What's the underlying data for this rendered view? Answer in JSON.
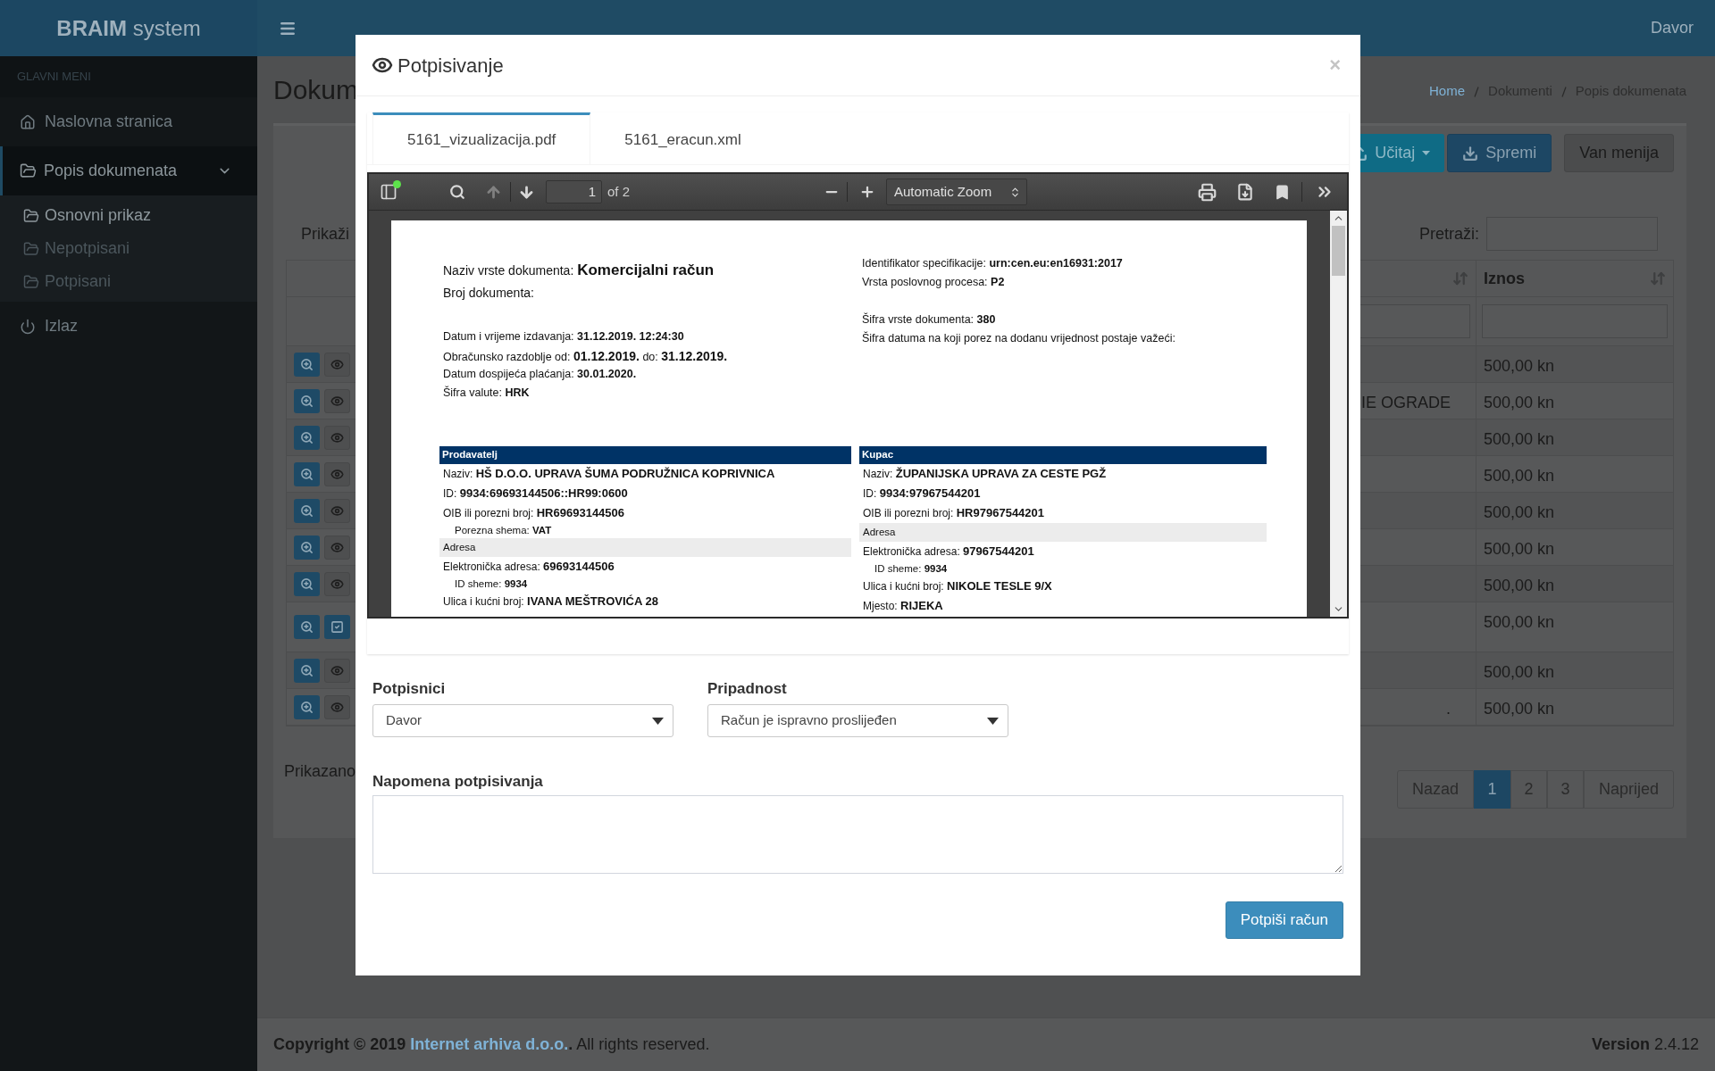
{
  "app": {
    "logo_bold": "BRAIM",
    "logo_light": "system",
    "user": "Davor"
  },
  "sidebar": {
    "heading": "GLAVNI MENI",
    "items": [
      {
        "kind": "link",
        "label": "Naslovna stranica"
      },
      {
        "kind": "group",
        "label": "Popis dokumenata",
        "expanded": true,
        "children": [
          {
            "label": "Osnovni prikaz",
            "selected": true
          },
          {
            "label": "Nepotpisani",
            "selected": false
          },
          {
            "label": "Potpisani",
            "selected": false
          }
        ]
      },
      {
        "kind": "link",
        "label": "Izlaz"
      }
    ]
  },
  "page": {
    "title": "Dokum",
    "breadcrumb": [
      "Home",
      "Dokumenti",
      "Popis dokumenata"
    ]
  },
  "actions": [
    {
      "kind": "info",
      "label": "Učitaj"
    },
    {
      "kind": "primary",
      "label": "Spremi"
    },
    {
      "kind": "plain",
      "label": "Van menija"
    }
  ],
  "table": {
    "length_label": "Prikaži",
    "search_label": "Pretraži:",
    "columns": [
      "Iznos"
    ],
    "rows": [
      {
        "kind": "view",
        "amount": "500,00 kn"
      },
      {
        "kind": "view",
        "cell": "IE OGRADE",
        "amount": "500,00 kn"
      },
      {
        "kind": "view",
        "amount": "500,00 kn"
      },
      {
        "kind": "view",
        "amount": "500,00 kn"
      },
      {
        "kind": "view",
        "amount": "500,00 kn"
      },
      {
        "kind": "view",
        "amount": "500,00 kn"
      },
      {
        "kind": "view",
        "amount": "500,00 kn"
      },
      {
        "kind": "check",
        "amount": "500,00 kn"
      },
      {
        "kind": "view",
        "amount": "500,00 kn"
      },
      {
        "kind": "view",
        "cell": ".",
        "amount": "500,00 kn"
      }
    ],
    "info": "Prikazano"
  },
  "pagination": {
    "prev": "Nazad",
    "next": "Naprijed",
    "pages": [
      {
        "label": "1",
        "selected": true
      },
      {
        "label": "2",
        "selected": false
      },
      {
        "label": "3",
        "selected": false
      }
    ]
  },
  "footer": {
    "copyright": "Copyright © 2019 ",
    "link": "Internet arhiva d.o.o.",
    "rest": ". All rights reserved.",
    "version": "**Version** 2.4.12"
  },
  "modal": {
    "title": "Potpisivanje",
    "close": "×",
    "tabs": [
      {
        "label": "5161_vizualizacija.pdf",
        "selected": true
      },
      {
        "label": "5161_eracun.xml",
        "selected": false
      }
    ],
    "viewer": {
      "page": "1",
      "page_count": "of 2",
      "zoom": "Automatic Zoom",
      "previous_disabled": true,
      "next_disabled": false
    },
    "document": {
      "header_left": [
        [
          {
            "kind": "title",
            "label": "Naziv vrste dokumenta:",
            "value": "Komercijalni račun"
          },
          {
            "kind": "field",
            "label": "Broj dokumenta:"
          }
        ],
        [
          {
            "kind": "small",
            "label": "Datum i vrijeme izdavanja:",
            "value": "31.12.2019. 12:24:30"
          },
          {
            "kind": "period",
            "label": "Obračunsko razdoblje od:",
            "value": "01.12.2019.",
            "label_2": "do:",
            "value_2": "31.12.2019."
          },
          {
            "kind": "small",
            "label": "Datum dospijeća plaćanja:",
            "value": "30.01.2020."
          },
          {
            "kind": "small",
            "label": "Šifra valute:",
            "value": "HRK"
          }
        ]
      ],
      "header_right": [
        [
          {
            "kind": "small",
            "label": "Identifikator specifikacije:",
            "value": "urn:cen.eu:en16931:2017"
          },
          {
            "kind": "small",
            "label": "Vrsta poslovnog procesa:",
            "value": "P2"
          }
        ],
        [
          {
            "kind": "small",
            "label": "Šifra vrste dokumenta:",
            "value": "380"
          },
          {
            "kind": "small",
            "label": "Šifra datuma na koji porez na dodanu vrijednost postaje važeći:"
          }
        ]
      ],
      "parties": [
        {
          "title": "Prodavatelj",
          "rows": [
            {
              "kind": "field",
              "label": "Naziv:",
              "value": "HŠ D.O.O. UPRAVA ŠUMA PODRUŽNICA KOPRIVNICA"
            },
            {
              "kind": "field",
              "label": "ID:",
              "value": "9934:69693144506::HR99:0600"
            },
            {
              "kind": "field",
              "label": "OIB ili porezni broj:",
              "value": "HR69693144506"
            },
            {
              "kind": "sub",
              "label": "Porezna shema:",
              "value": "VAT"
            },
            {
              "kind": "band",
              "label": "Adresa"
            },
            {
              "kind": "field",
              "label": "Elektronička adresa:",
              "value": "69693144506"
            },
            {
              "kind": "sub",
              "label": "ID sheme:",
              "value": "9934"
            },
            {
              "kind": "field",
              "label": "Ulica i kućni broj:",
              "value": "IVANA MEŠTROVIĆA 28"
            }
          ]
        },
        {
          "title": "Kupac",
          "rows": [
            {
              "kind": "field",
              "label": "Naziv:",
              "value": "ŽUPANIJSKA UPRAVA ZA CESTE PGŽ"
            },
            {
              "kind": "field",
              "label": "ID:",
              "value": "9934:97967544201"
            },
            {
              "kind": "field",
              "label": "OIB ili porezni broj:",
              "value": "HR97967544201"
            },
            {
              "kind": "band",
              "label": "Adresa"
            },
            {
              "kind": "field",
              "label": "Elektronička adresa:",
              "value": "97967544201"
            },
            {
              "kind": "sub",
              "label": "ID sheme:",
              "value": "9934"
            },
            {
              "kind": "field",
              "label": "Ulica i kućni broj:",
              "value": "NIKOLE TESLE 9/X"
            },
            {
              "kind": "field",
              "label": "Mjesto:",
              "value": "RIJEKA"
            }
          ]
        }
      ]
    },
    "form": {
      "signers": {
        "label": "Potpisnici",
        "value": "Davor"
      },
      "affiliation": {
        "label": "Pripadnost",
        "value": "Račun je ispravno proslijeđen"
      },
      "note": {
        "label": "Napomena potpisivanja"
      },
      "submit": "Potpiši račun"
    }
  }
}
